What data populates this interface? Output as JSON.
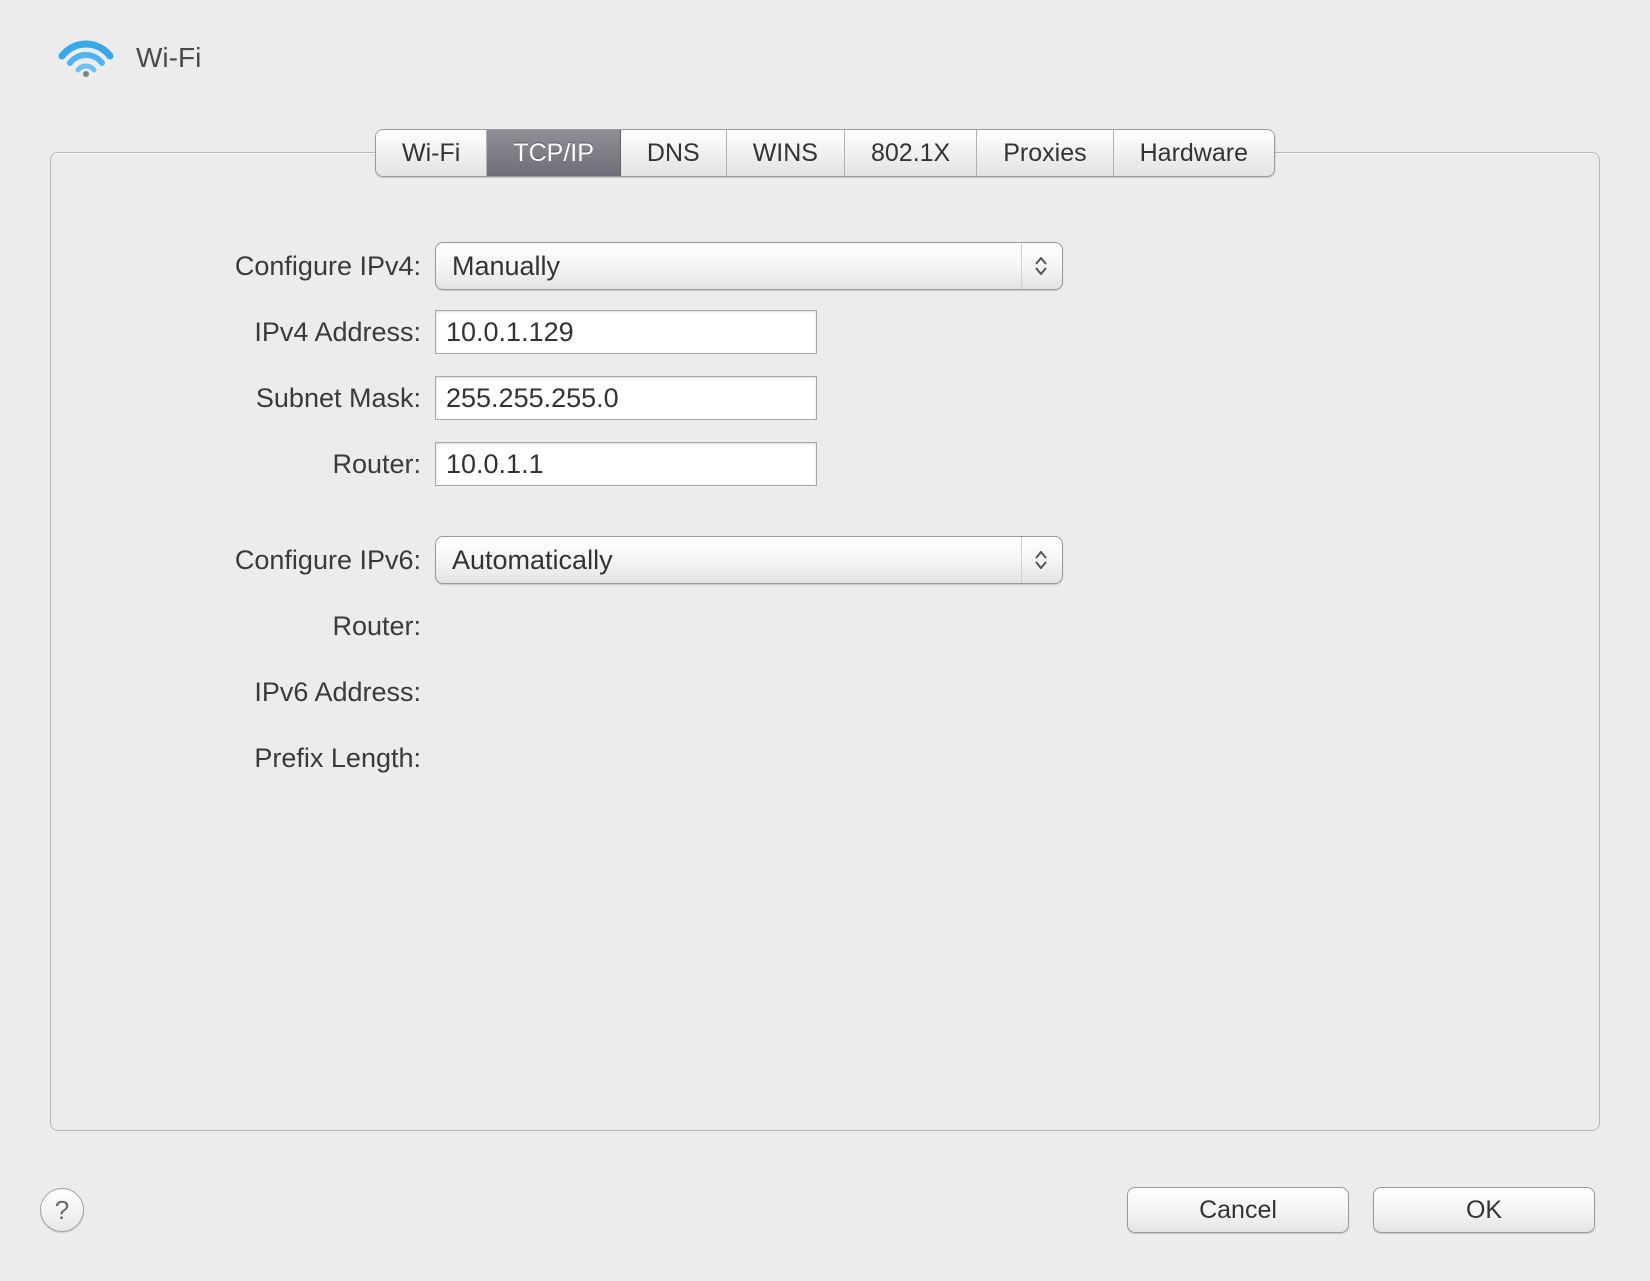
{
  "header": {
    "title": "Wi-Fi"
  },
  "tabs": [
    {
      "label": "Wi-Fi",
      "selected": false
    },
    {
      "label": "TCP/IP",
      "selected": true
    },
    {
      "label": "DNS",
      "selected": false
    },
    {
      "label": "WINS",
      "selected": false
    },
    {
      "label": "802.1X",
      "selected": false
    },
    {
      "label": "Proxies",
      "selected": false
    },
    {
      "label": "Hardware",
      "selected": false
    }
  ],
  "form": {
    "configure_ipv4_label": "Configure IPv4:",
    "configure_ipv4_value": "Manually",
    "ipv4_address_label": "IPv4 Address:",
    "ipv4_address_value": "10.0.1.129",
    "subnet_mask_label": "Subnet Mask:",
    "subnet_mask_value": "255.255.255.0",
    "router_v4_label": "Router:",
    "router_v4_value": "10.0.1.1",
    "configure_ipv6_label": "Configure IPv6:",
    "configure_ipv6_value": "Automatically",
    "router_v6_label": "Router:",
    "router_v6_value": "",
    "ipv6_address_label": "IPv6 Address:",
    "ipv6_address_value": "",
    "prefix_length_label": "Prefix Length:",
    "prefix_length_value": ""
  },
  "buttons": {
    "help": "?",
    "cancel": "Cancel",
    "ok": "OK"
  }
}
